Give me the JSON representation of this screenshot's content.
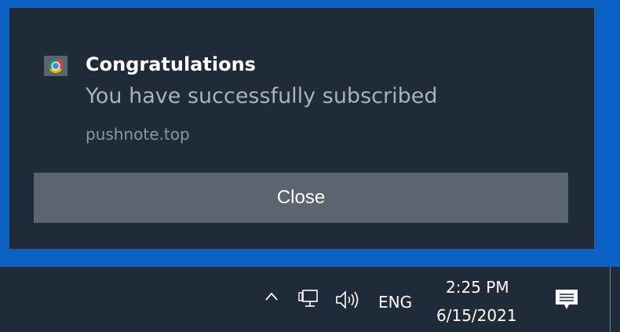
{
  "notification": {
    "app_icon": "chrome-icon",
    "title": "Congratulations",
    "message": "You have successfully subscribed",
    "source": "pushnote.top",
    "close_label": "Close"
  },
  "taskbar": {
    "tray_icons": [
      "chevron-up-icon",
      "network-icon",
      "volume-icon"
    ],
    "language": "ENG",
    "time": "2:25 PM",
    "date": "6/15/2021",
    "action_center_icon": "notification-icon"
  },
  "colors": {
    "desktop_blue": "#0b62c4",
    "toast_background": "#1f2b39",
    "button_background": "#5b6570",
    "title_text": "#ffffff",
    "message_text": "#a9b1ba",
    "source_text": "#8b96a2"
  }
}
